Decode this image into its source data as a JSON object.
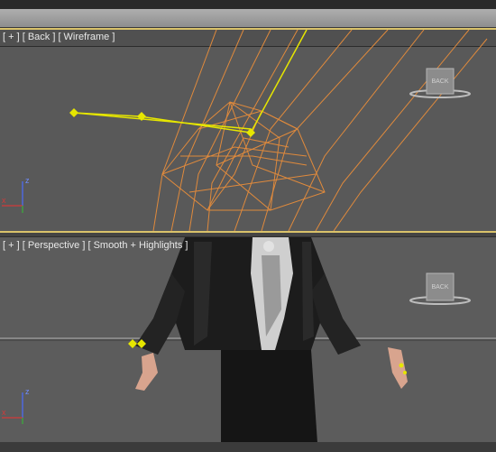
{
  "viewports": {
    "top": {
      "label": "[ + ] [ Back ] [ Wireframe ]",
      "cube_label": "BACK"
    },
    "bottom": {
      "label": "[ + ] [ Perspective ] [ Smooth + Highlights ]",
      "cube_label": "BACK"
    }
  },
  "axes": {
    "z": "z",
    "x": "x"
  },
  "colors": {
    "wireframe": "#e08a3c",
    "bone": "#e6e600",
    "active_border": "#d9c26a",
    "viewport_bg": "#595959"
  }
}
